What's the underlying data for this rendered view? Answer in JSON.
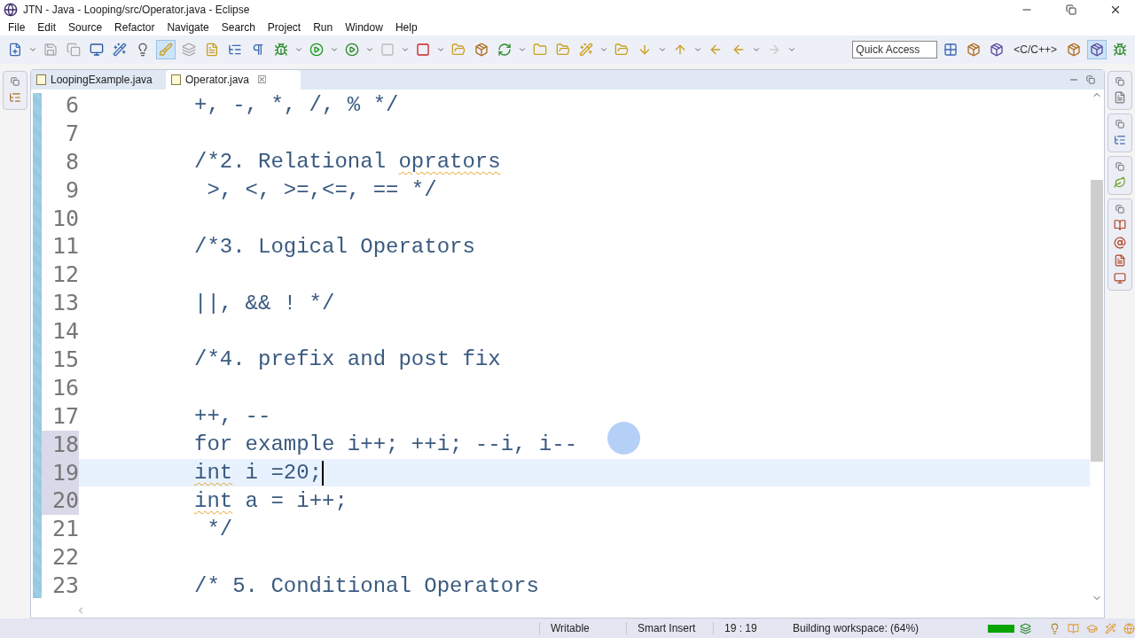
{
  "window": {
    "title": "JTN - Java - Looping/src/Operator.java - Eclipse"
  },
  "menu": [
    "File",
    "Edit",
    "Source",
    "Refactor",
    "Navigate",
    "Search",
    "Project",
    "Run",
    "Window",
    "Help"
  ],
  "quick_access": {
    "placeholder": "Quick Access"
  },
  "perspective": {
    "label": "<C/C++>"
  },
  "tabs": [
    {
      "label": "LoopingExample.java",
      "selected": false
    },
    {
      "label": "Operator.java",
      "selected": true,
      "close": "☒"
    }
  ],
  "editor": {
    "lines": [
      {
        "number": "6",
        "marked": false,
        "current": false,
        "segments": [
          {
            "text": "+, -, *, /, % */"
          }
        ]
      },
      {
        "number": "7",
        "marked": false,
        "current": false
      },
      {
        "number": "8",
        "marked": false,
        "current": false,
        "segments": [
          {
            "text": "/*2. Relational "
          },
          {
            "text": "oprators",
            "misspelled": true
          }
        ]
      },
      {
        "number": "9",
        "marked": false,
        "current": false,
        "segments": [
          {
            "text": " >, <, >=,<=, == */"
          }
        ]
      },
      {
        "number": "10",
        "marked": false,
        "current": false
      },
      {
        "number": "11",
        "marked": false,
        "current": false,
        "segments": [
          {
            "text": "/*3. Logical Operators"
          }
        ]
      },
      {
        "number": "12",
        "marked": false,
        "current": false
      },
      {
        "number": "13",
        "marked": false,
        "current": false,
        "segments": [
          {
            "text": "||, && ! */"
          }
        ]
      },
      {
        "number": "14",
        "marked": false,
        "current": false
      },
      {
        "number": "15",
        "marked": false,
        "current": false,
        "segments": [
          {
            "text": "/*4. prefix and post fix"
          }
        ]
      },
      {
        "number": "16",
        "marked": false,
        "current": false
      },
      {
        "number": "17",
        "marked": false,
        "current": false,
        "segments": [
          {
            "text": "++, --"
          }
        ]
      },
      {
        "number": "18",
        "marked": true,
        "current": false,
        "segments": [
          {
            "text": "for example i++; ++i; --i, i--"
          }
        ]
      },
      {
        "number": "19",
        "marked": true,
        "current": true,
        "segments": [
          {
            "text": "int",
            "misspelled": true
          },
          {
            "text": " i =20;"
          }
        ]
      },
      {
        "number": "20",
        "marked": true,
        "current": false,
        "segments": [
          {
            "text": "int",
            "misspelled": true
          },
          {
            "text": " a = i++;"
          }
        ]
      },
      {
        "number": "21",
        "marked": false,
        "current": false,
        "segments": [
          {
            "text": " */"
          }
        ]
      },
      {
        "number": "22",
        "marked": false,
        "current": false
      },
      {
        "number": "23",
        "marked": false,
        "current": false,
        "segments": [
          {
            "text": "/* 5. Conditional Operators"
          }
        ]
      }
    ]
  },
  "status_bar": {
    "mode": "Writable",
    "insert": "Smart Insert",
    "position": "19 : 19",
    "task": "Building workspace: (64%)",
    "progress": {
      "level": 1
    }
  }
}
